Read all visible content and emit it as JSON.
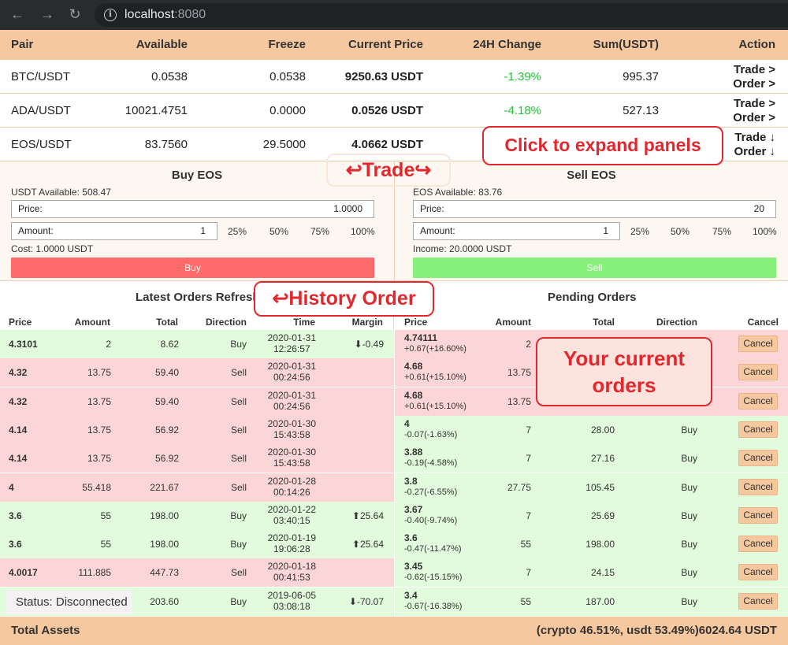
{
  "browser": {
    "url_host": "localhost",
    "url_port": ":8080"
  },
  "holdings": {
    "headers": [
      "Pair",
      "Available",
      "Freeze",
      "Current Price",
      "24H Change",
      "Sum(USDT)",
      "Action"
    ],
    "rows": [
      {
        "pair": "BTC/USDT",
        "available": "0.0538",
        "freeze": "0.0538",
        "price": "9250.63 USDT",
        "change": "-1.39%",
        "sum": "995.37",
        "trade": "Trade >",
        "order": "Order >"
      },
      {
        "pair": "ADA/USDT",
        "available": "10021.4751",
        "freeze": "0.0000",
        "price": "0.0526 USDT",
        "change": "-4.18%",
        "sum": "527.13",
        "trade": "Trade >",
        "order": "Order >"
      },
      {
        "pair": "EOS/USDT",
        "available": "83.7560",
        "freeze": "29.5000",
        "price": "4.0662 USDT",
        "change": "",
        "sum": "",
        "trade": "Trade ↓",
        "order": "Order ↓"
      }
    ]
  },
  "buy_panel": {
    "title": "Buy EOS",
    "available": "USDT Available: 508.47",
    "price_label": "Price:",
    "price_value": "1.0000",
    "amount_label": "Amount:",
    "amount_value": "1",
    "pcts": [
      "25%",
      "50%",
      "75%",
      "100%"
    ],
    "cost": "Cost: 1.0000 USDT",
    "button": "Buy"
  },
  "sell_panel": {
    "title": "Sell EOS",
    "available": "EOS Available: 83.76",
    "price_label": "Price:",
    "price_value": "20",
    "amount_label": "Amount:",
    "amount_value": "1",
    "pcts": [
      "25%",
      "50%",
      "75%",
      "100%"
    ],
    "income": "Income: 20.0000 USDT",
    "button": "Sell"
  },
  "latest_orders": {
    "title": "Latest Orders Refresh",
    "headers": [
      "Price",
      "Amount",
      "Total",
      "Direction",
      "Time",
      "Margin"
    ],
    "rows": [
      {
        "side": "buy",
        "price": "4.3101",
        "amount": "2",
        "total": "8.62",
        "direction": "Buy",
        "date": "2020-01-31",
        "time": "12:26:57",
        "margin": "⬇-0.49"
      },
      {
        "side": "sell",
        "price": "4.32",
        "amount": "13.75",
        "total": "59.40",
        "direction": "Sell",
        "date": "2020-01-31",
        "time": "00:24:56",
        "margin": ""
      },
      {
        "side": "sell",
        "price": "4.32",
        "amount": "13.75",
        "total": "59.40",
        "direction": "Sell",
        "date": "2020-01-31",
        "time": "00:24:56",
        "margin": ""
      },
      {
        "side": "sell",
        "price": "4.14",
        "amount": "13.75",
        "total": "56.92",
        "direction": "Sell",
        "date": "2020-01-30",
        "time": "15:43:58",
        "margin": ""
      },
      {
        "side": "sell",
        "price": "4.14",
        "amount": "13.75",
        "total": "56.92",
        "direction": "Sell",
        "date": "2020-01-30",
        "time": "15:43:58",
        "margin": ""
      },
      {
        "side": "sell",
        "price": "4",
        "amount": "55.418",
        "total": "221.67",
        "direction": "Sell",
        "date": "2020-01-28",
        "time": "00:14:26",
        "margin": ""
      },
      {
        "side": "buy",
        "price": "3.6",
        "amount": "55",
        "total": "198.00",
        "direction": "Buy",
        "date": "2020-01-22",
        "time": "03:40:15",
        "margin": "⬆25.64"
      },
      {
        "side": "buy",
        "price": "3.6",
        "amount": "55",
        "total": "198.00",
        "direction": "Buy",
        "date": "2020-01-19",
        "time": "19:06:28",
        "margin": "⬆25.64"
      },
      {
        "side": "sell",
        "price": "4.0017",
        "amount": "111.885",
        "total": "447.73",
        "direction": "Sell",
        "date": "2020-01-18",
        "time": "00:41:53",
        "margin": ""
      },
      {
        "side": "buy",
        "price": "",
        "amount": "",
        "total": "203.60",
        "direction": "Buy",
        "date": "2019-06-05",
        "time": "03:08:18",
        "margin": "⬇-70.07"
      }
    ]
  },
  "pending_orders": {
    "title": "Pending Orders",
    "headers": [
      "Price",
      "Amount",
      "Total",
      "Direction",
      "Cancel"
    ],
    "cancel_label": "Cancel",
    "rows": [
      {
        "side": "sell",
        "price": "4.74111",
        "change": "+0.67(+16.60%)",
        "amount": "2",
        "total": "",
        "direction": ""
      },
      {
        "side": "sell",
        "price": "4.68",
        "change": "+0.61(+15.10%)",
        "amount": "13.75",
        "total": "",
        "direction": ""
      },
      {
        "side": "sell",
        "price": "4.68",
        "change": "+0.61(+15.10%)",
        "amount": "13.75",
        "total": "",
        "direction": ""
      },
      {
        "side": "buy",
        "price": "4",
        "change": "-0.07(-1.63%)",
        "amount": "7",
        "total": "28.00",
        "direction": "Buy"
      },
      {
        "side": "buy",
        "price": "3.88",
        "change": "-0.19(-4.58%)",
        "amount": "7",
        "total": "27.16",
        "direction": "Buy"
      },
      {
        "side": "buy",
        "price": "3.8",
        "change": "-0.27(-6.55%)",
        "amount": "27.75",
        "total": "105.45",
        "direction": "Buy"
      },
      {
        "side": "buy",
        "price": "3.67",
        "change": "-0.40(-9.74%)",
        "amount": "7",
        "total": "25.69",
        "direction": "Buy"
      },
      {
        "side": "buy",
        "price": "3.6",
        "change": "-0.47(-11.47%)",
        "amount": "55",
        "total": "198.00",
        "direction": "Buy"
      },
      {
        "side": "buy",
        "price": "3.45",
        "change": "-0.62(-15.15%)",
        "amount": "7",
        "total": "24.15",
        "direction": "Buy"
      },
      {
        "side": "buy",
        "price": "3.4",
        "change": "-0.67(-16.38%)",
        "amount": "55",
        "total": "187.00",
        "direction": "Buy"
      }
    ]
  },
  "status": "Status: Disconnected",
  "footer": {
    "label": "Total Assets",
    "value": "(crypto 46.51%, usdt 53.49%)6024.64 USDT"
  },
  "annotations": {
    "expand": "Click to expand panels",
    "trade": "↩Trade↪",
    "history": "↩History Order",
    "current_line1": "Your current",
    "current_line2": "orders"
  },
  "colors": {
    "header_bg": "#f6c89f",
    "buy_row": "#e2fbdc",
    "sell_row": "#fcd6d6",
    "buy_button": "#ff6b6b",
    "sell_button": "#87f07a",
    "change_green": "#22c43a",
    "annotation_red": "#e0282e"
  }
}
